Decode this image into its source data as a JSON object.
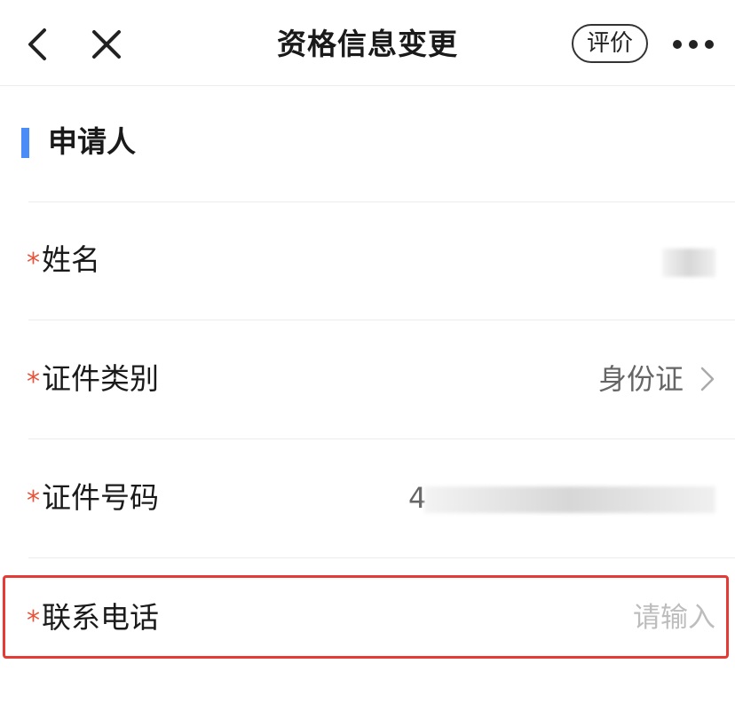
{
  "header": {
    "title": "资格信息变更",
    "rate_label": "评价",
    "back_icon": "chevron-left-icon",
    "close_icon": "close-icon",
    "more_icon": "more-horizontal-icon"
  },
  "section": {
    "title": "申请人",
    "accent_color": "#4a8df8"
  },
  "required_marker": "*",
  "required_color": "#e8533a",
  "form": {
    "name": {
      "label": "姓名",
      "value_redacted": true
    },
    "id_type": {
      "label": "证件类别",
      "value": "身份证",
      "icon": "chevron-right-icon"
    },
    "id_number": {
      "label": "证件号码",
      "value_prefix": "4",
      "value_redacted": true
    },
    "phone": {
      "label": "联系电话",
      "placeholder": "请输入",
      "value": ""
    }
  },
  "highlight_color": "#e53b36"
}
